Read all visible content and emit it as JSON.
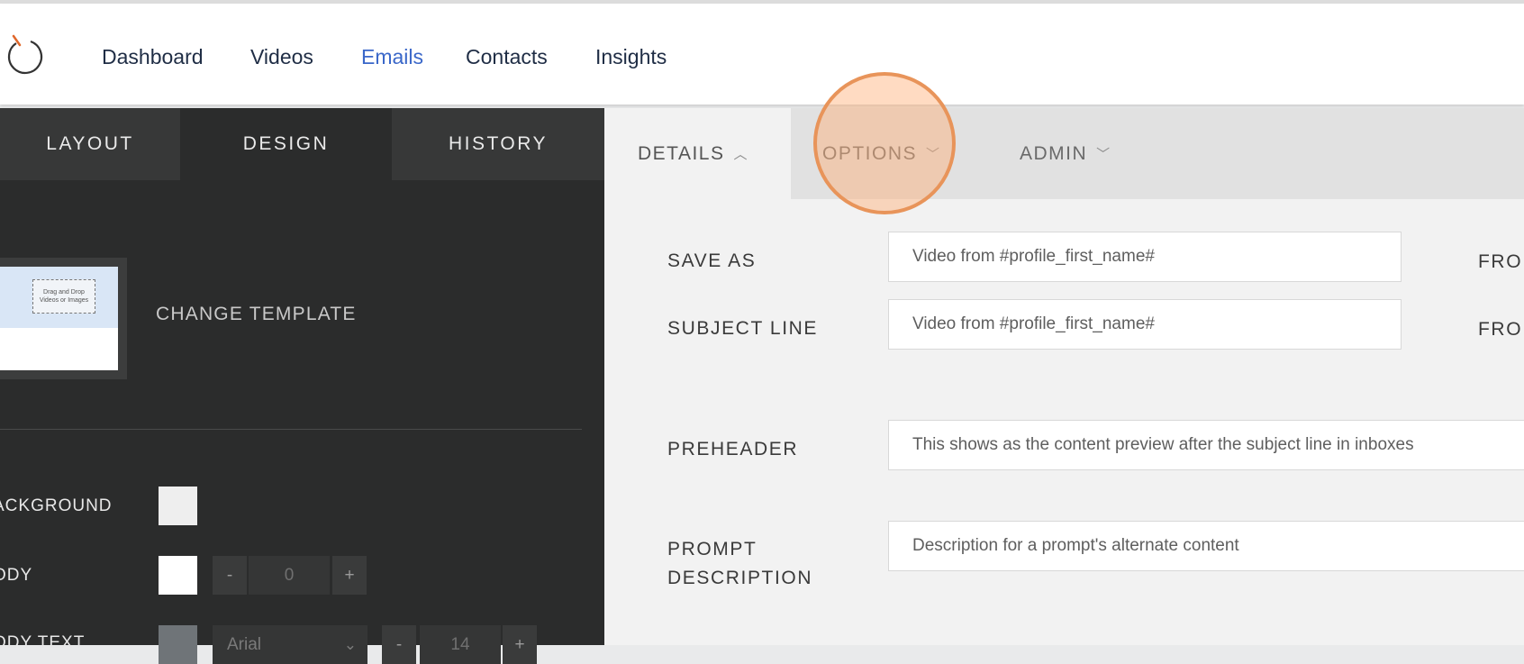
{
  "nav": {
    "links": [
      "Dashboard",
      "Videos",
      "Emails",
      "Contacts",
      "Insights"
    ],
    "active": "Emails"
  },
  "sidebar": {
    "tabs": [
      "LAYOUT",
      "DESIGN",
      "HISTORY"
    ],
    "active_tab": "DESIGN",
    "template_preview_text": "Drag and Drop Videos or Images",
    "change_template_label": "CHANGE TEMPLATE",
    "rows": {
      "background": {
        "label": "ACKGROUND",
        "color": "#eeeeee"
      },
      "body": {
        "label": "ODY",
        "color": "#ffffff",
        "minus": "-",
        "value": "0",
        "plus": "+"
      },
      "body_text": {
        "label": "ODY TEXT",
        "color": "#6f7478",
        "font": "Arial",
        "minus": "-",
        "size": "14",
        "plus": "+"
      }
    }
  },
  "content": {
    "tabs": [
      {
        "label": "DETAILS",
        "icon": "chevron-up-icon"
      },
      {
        "label": "OPTIONS",
        "icon": "chevron-down-icon"
      },
      {
        "label": "ADMIN",
        "icon": "chevron-down-icon"
      }
    ],
    "active_tab": "DETAILS",
    "fields": {
      "save_as": {
        "label": "SAVE AS",
        "value": "Video from #profile_first_name#"
      },
      "subject_line": {
        "label": "SUBJECT LINE",
        "value": "Video from #profile_first_name#"
      },
      "preheader": {
        "label": "PREHEADER",
        "placeholder": "This shows as the content preview after the subject line in inboxes"
      },
      "prompt_description": {
        "label_line1": "PROMPT",
        "label_line2": "DESCRIPTION",
        "placeholder": "Description for a prompt's alternate content"
      }
    },
    "right_labels": [
      "FRO",
      "FRO"
    ]
  },
  "colors": {
    "accent": "#3a67c9",
    "highlight": "#e8945a",
    "sidebar_bg": "#2b2c2c"
  }
}
